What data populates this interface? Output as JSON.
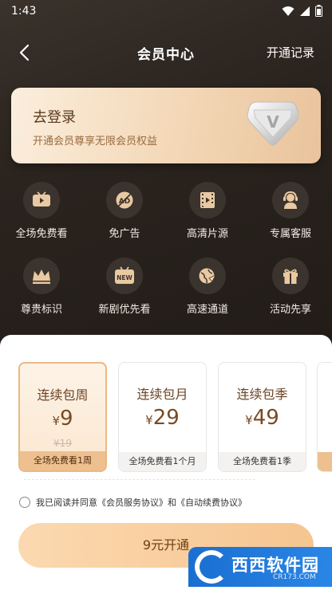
{
  "status_bar": {
    "time": "1:43"
  },
  "nav": {
    "title": "会员中心",
    "right_label": "开通记录"
  },
  "login_card": {
    "title": "去登录",
    "subtitle": "开通会员尊享无限会员权益",
    "badge_letter": "V"
  },
  "benefits": [
    {
      "label": "全场免费看",
      "icon": "tv-icon"
    },
    {
      "label": "免广告",
      "icon": "no-ad-icon"
    },
    {
      "label": "高清片源",
      "icon": "film-icon"
    },
    {
      "label": "专属客服",
      "icon": "customer-service-icon"
    },
    {
      "label": "尊贵标识",
      "icon": "crown-icon"
    },
    {
      "label": "新剧优先看",
      "icon": "new-icon"
    },
    {
      "label": "高速通道",
      "icon": "speed-globe-icon"
    },
    {
      "label": "活动先享",
      "icon": "gift-icon"
    }
  ],
  "plans": [
    {
      "name": "连续包周",
      "currency": "¥",
      "price": "9",
      "original": "¥19",
      "footer": "全场免费看1周",
      "selected": true
    },
    {
      "name": "连续包月",
      "currency": "¥",
      "price": "29",
      "original": "",
      "footer": "全场免费看1个月",
      "selected": false
    },
    {
      "name": "连续包季",
      "currency": "¥",
      "price": "49",
      "original": "",
      "footer": "全场免费看1季",
      "selected": false
    }
  ],
  "agreement": {
    "prefix": "我已阅读并同意",
    "service_link": "《会员服务协议》",
    "joiner": "和",
    "renew_link": "《自动续费协议》"
  },
  "pay_button": {
    "label": "9元开通"
  },
  "watermark": {
    "text": "西西软件园",
    "sub": "CR173.COM"
  },
  "colors": {
    "accent": "#eec08f",
    "dark_bg": "#241e1a",
    "gold_text": "#7a4a24"
  }
}
